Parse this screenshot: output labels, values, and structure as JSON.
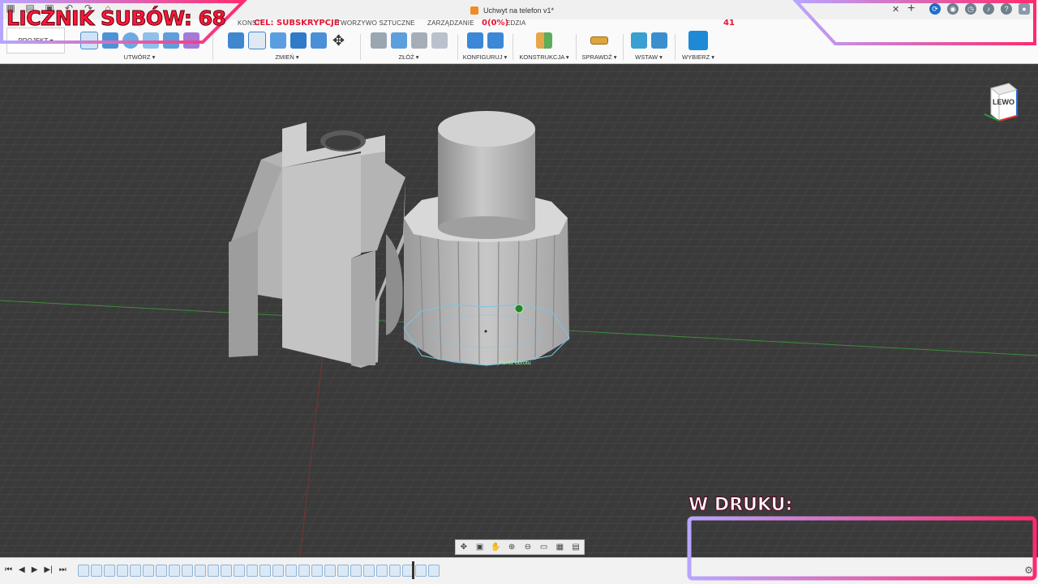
{
  "app": {
    "document_title": "Uchwyt na telefon v1*"
  },
  "ribbon": {
    "workspace_label": "PROJEKT ▾",
    "tabs": [
      "KONST",
      "TWORZYWO SZTUCZNE",
      "ZARZĄDZANIE",
      "EDZIA"
    ],
    "groups": [
      {
        "label": "UTWÓRZ ▾"
      },
      {
        "label": "ZMIEŃ ▾"
      },
      {
        "label": "ZŁÓŻ ▾"
      },
      {
        "label": "KONFIGURUJ ▾"
      },
      {
        "label": "KONSTRUKCJA ▾"
      },
      {
        "label": "SPRAWDŹ ▾"
      },
      {
        "label": "WSTAW ▾"
      },
      {
        "label": "WYBIERZ ▾"
      }
    ]
  },
  "viewport": {
    "viewcube_label": "LEWO",
    "pivot_label": "Punkt obrotu"
  },
  "overlay": {
    "sub_counter": "LICZNIK SUBÓW: 68",
    "goal_label": "CEL: SUBSKRYPCJE",
    "goal_progress": "0(0%)",
    "goal_target": "41",
    "printing_label": "W DRUKU:"
  },
  "icons": {
    "quick_access": [
      "grid-icon",
      "file-icon",
      "save-icon",
      "undo-icon",
      "redo-icon",
      "home-icon"
    ],
    "title_right": [
      "close-icon",
      "plus-icon",
      "refresh-icon",
      "user-icon",
      "clock-icon",
      "bell-icon",
      "help-icon",
      "avatar-icon"
    ],
    "navbar": [
      "orbit-icon",
      "look-at-icon",
      "pan-icon",
      "zoom-icon",
      "fit-icon",
      "display-icon",
      "grid-settings-icon",
      "viewports-icon"
    ],
    "timeline": [
      "skip-start-icon",
      "step-back-icon",
      "play-icon",
      "step-forward-icon",
      "skip-end-icon"
    ]
  },
  "colors": {
    "overlay_red": "#ff1737",
    "frame_gradient_start": "#b8a5ff",
    "frame_gradient_end": "#ff2a6d",
    "accent_blue": "#1f6ec7"
  }
}
